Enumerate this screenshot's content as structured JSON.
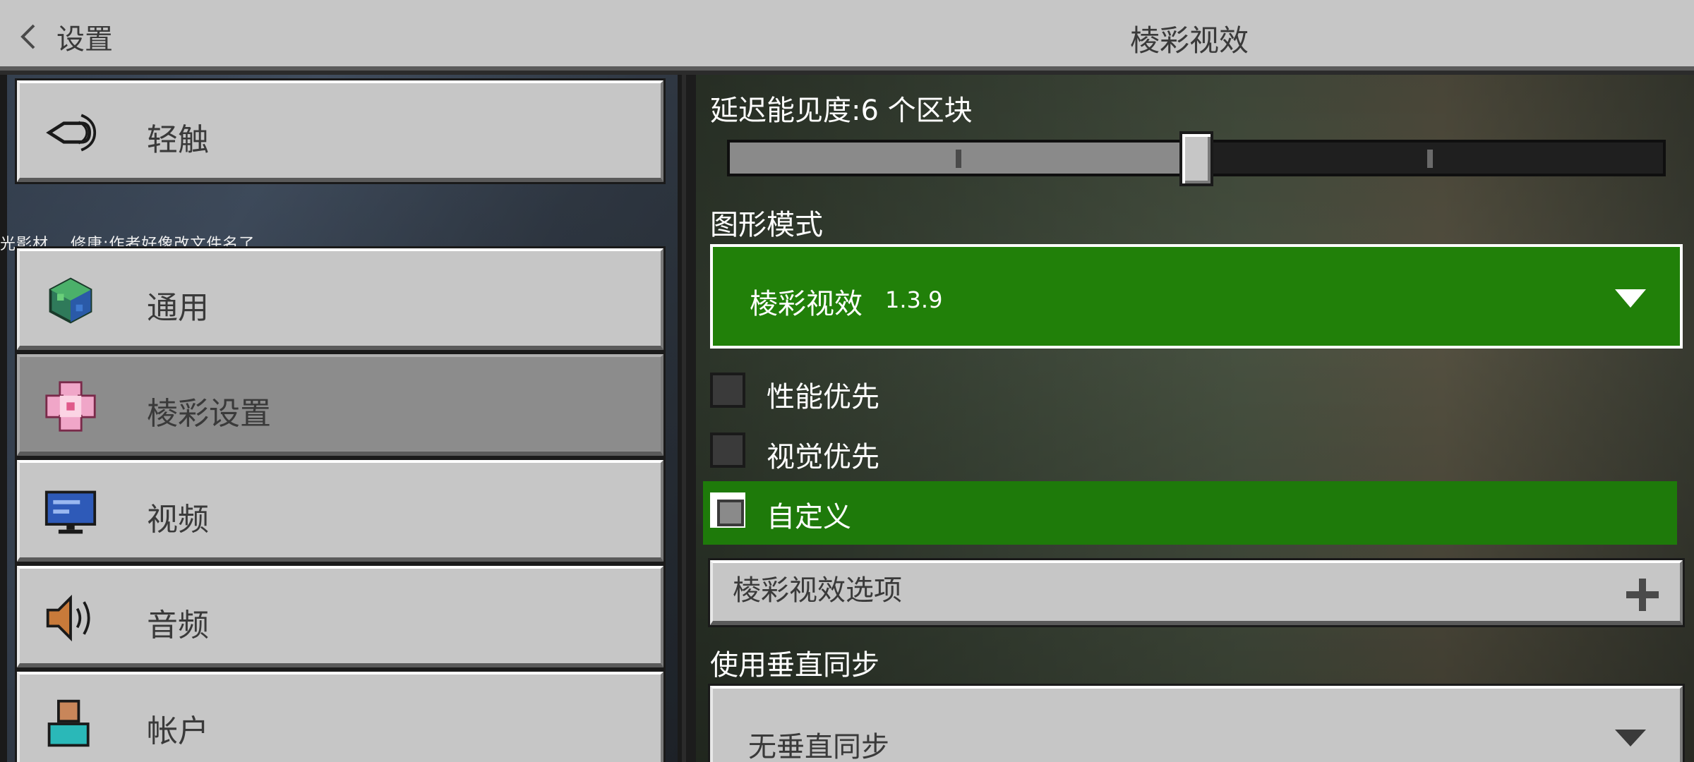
{
  "header": {
    "back_label": "设置",
    "title": "棱彩视效"
  },
  "sidebar": {
    "watermark": "光影材…  修唐:作者好像改文件名了",
    "section_title": "通用",
    "items": [
      {
        "label": "轻触",
        "icon": "touch-hand-icon"
      },
      {
        "label": "通用",
        "icon": "globe-cube-icon"
      },
      {
        "label": "棱彩设置",
        "icon": "pink-flower-icon",
        "selected": true
      },
      {
        "label": "视频",
        "icon": "monitor-icon"
      },
      {
        "label": "音频",
        "icon": "speaker-icon"
      },
      {
        "label": "帐户",
        "icon": "account-person-icon"
      }
    ]
  },
  "content": {
    "render_distance": {
      "label": "延迟能见度:6 个区块",
      "value": 6,
      "fill_fraction": 0.5
    },
    "graphics_mode": {
      "label": "图形模式",
      "selected": "棱彩视效",
      "version": "1.3.9"
    },
    "presets": [
      {
        "label": "性能优先",
        "checked": false
      },
      {
        "label": "视觉优先",
        "checked": false
      },
      {
        "label": "自定义",
        "checked": true
      }
    ],
    "options_section": {
      "label": "棱彩视效选项"
    },
    "vsync": {
      "label": "使用垂直同步",
      "selected": "无垂直同步"
    }
  },
  "colors": {
    "panel_gray": "#c6c6c6",
    "accent_green": "#218009",
    "text_dark": "#3a3a3a"
  }
}
